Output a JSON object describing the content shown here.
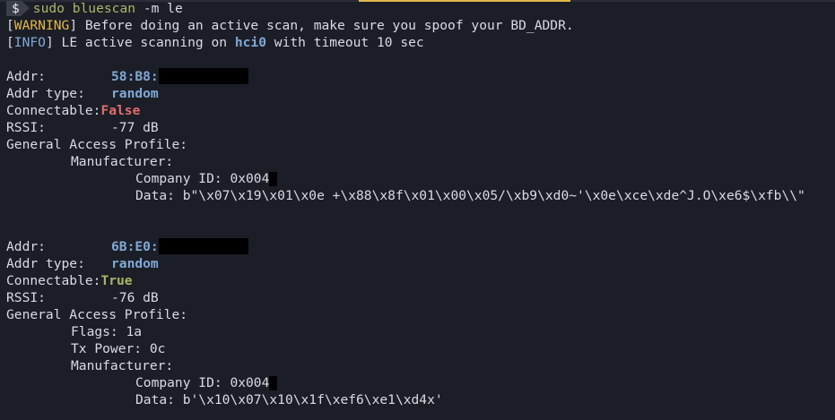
{
  "terminal": {
    "prompt_symbol": "$",
    "command": "sudo bluescan",
    "command_args": " -m le",
    "warning": {
      "open_bracket": "[",
      "tag": "WARNING",
      "close_bracket": "]",
      "text": " Before doing an active scan, make sure you spoof your BD_ADDR."
    },
    "info": {
      "open_bracket": "[",
      "tag": "INFO",
      "close_bracket": "]",
      "text_before": " LE active scanning on ",
      "interface": "hci0",
      "text_after": " with timeout 10 sec"
    }
  },
  "devices": [
    {
      "addr_label": "Addr:",
      "addr_value": "58:B8:",
      "addr_type_label": "Addr type:",
      "addr_type_value": "random",
      "connectable_label": "Connectable:",
      "connectable_value": "False",
      "rssi_label": "RSSI:",
      "rssi_value": "-77 dB",
      "gap_label": "General Access Profile:",
      "manufacturer_label": "Manufacturer:",
      "company_id_label": "Company ID: ",
      "company_id_value": "0x004",
      "data_label": "Data: ",
      "data_value": "b\"\\x07\\x19\\x01\\x0e +\\x88\\x8f\\x01\\x00\\x05/\\xb9\\xd0~'\\x0e\\xce\\xde^J.O\\xe6$\\xfb\\\\\""
    },
    {
      "addr_label": "Addr:",
      "addr_value": "6B:E0:",
      "addr_type_label": "Addr type:",
      "addr_type_value": "random",
      "connectable_label": "Connectable:",
      "connectable_value": "True",
      "rssi_label": "RSSI:",
      "rssi_value": "-76 dB",
      "gap_label": "General Access Profile:",
      "flags_label": "Flags: ",
      "flags_value": "1a",
      "tx_power_label": "Tx Power: ",
      "tx_power_value": "0c",
      "manufacturer_label": "Manufacturer:",
      "company_id_label": "Company ID: ",
      "company_id_value": "0x004",
      "data_label": "Data: ",
      "data_value": "b'\\x10\\x07\\x10\\x1f\\xef6\\xe1\\xd4x'"
    }
  ],
  "colors": {
    "background": "#1c1e27",
    "text": "#d8dbe2",
    "command": "#a9b665",
    "warning": "#e0b84a",
    "info": "#7fa9d6",
    "false_value": "#e06c6c",
    "true_value": "#a9b665",
    "redaction": "#000000"
  }
}
